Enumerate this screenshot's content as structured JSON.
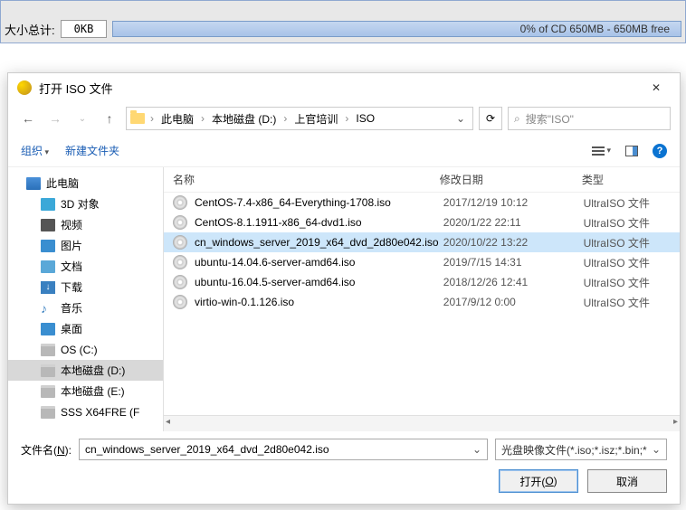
{
  "top": {
    "size_label": "大小总计:",
    "size_value": "0KB",
    "progress_text": "0% of CD 650MB - 650MB free"
  },
  "dialog": {
    "title": "打开 ISO 文件",
    "breadcrumbs": [
      "此电脑",
      "本地磁盘 (D:)",
      "上官培训",
      "ISO"
    ],
    "search_placeholder": "搜索\"ISO\"",
    "toolbar": {
      "organize": "组织",
      "new_folder": "新建文件夹"
    },
    "sidebar": [
      {
        "label": "此电脑",
        "icon": "ic-pc",
        "indent": false,
        "selected": false
      },
      {
        "label": "3D 对象",
        "icon": "ic-3d",
        "indent": true,
        "selected": false
      },
      {
        "label": "视频",
        "icon": "ic-video",
        "indent": true,
        "selected": false
      },
      {
        "label": "图片",
        "icon": "ic-image",
        "indent": true,
        "selected": false
      },
      {
        "label": "文档",
        "icon": "ic-doc",
        "indent": true,
        "selected": false
      },
      {
        "label": "下载",
        "icon": "ic-download",
        "indent": true,
        "selected": false
      },
      {
        "label": "音乐",
        "icon": "ic-music",
        "indent": true,
        "selected": false
      },
      {
        "label": "桌面",
        "icon": "ic-desktop",
        "indent": true,
        "selected": false
      },
      {
        "label": "OS (C:)",
        "icon": "ic-drive",
        "indent": true,
        "selected": false
      },
      {
        "label": "本地磁盘 (D:)",
        "icon": "ic-drive",
        "indent": true,
        "selected": true
      },
      {
        "label": "本地磁盘 (E:)",
        "icon": "ic-drive",
        "indent": true,
        "selected": false
      },
      {
        "label": "SSS X64FRE (F",
        "icon": "ic-drive",
        "indent": true,
        "selected": false
      }
    ],
    "columns": {
      "name": "名称",
      "date": "修改日期",
      "type": "类型"
    },
    "files": [
      {
        "name": "CentOS-7.4-x86_64-Everything-1708.iso",
        "date": "2017/12/19 10:12",
        "type": "UltraISO 文件",
        "selected": false
      },
      {
        "name": "CentOS-8.1.1911-x86_64-dvd1.iso",
        "date": "2020/1/22 22:11",
        "type": "UltraISO 文件",
        "selected": false
      },
      {
        "name": "cn_windows_server_2019_x64_dvd_2d80e042.iso",
        "date": "2020/10/22 13:22",
        "type": "UltraISO 文件",
        "selected": true
      },
      {
        "name": "ubuntu-14.04.6-server-amd64.iso",
        "date": "2019/7/15 14:31",
        "type": "UltraISO 文件",
        "selected": false
      },
      {
        "name": "ubuntu-16.04.5-server-amd64.iso",
        "date": "2018/12/26 12:41",
        "type": "UltraISO 文件",
        "selected": false
      },
      {
        "name": "virtio-win-0.1.126.iso",
        "date": "2017/9/12 0:00",
        "type": "UltraISO 文件",
        "selected": false
      }
    ],
    "filename_label_pre": "文件名(",
    "filename_label_key": "N",
    "filename_label_post": "):",
    "filename_value": "cn_windows_server_2019_x64_dvd_2d80e042.iso",
    "filter_value": "光盘映像文件(*.iso;*.isz;*.bin;*",
    "open_btn_pre": "打开(",
    "open_btn_key": "O",
    "open_btn_post": ")",
    "cancel_btn": "取消"
  }
}
